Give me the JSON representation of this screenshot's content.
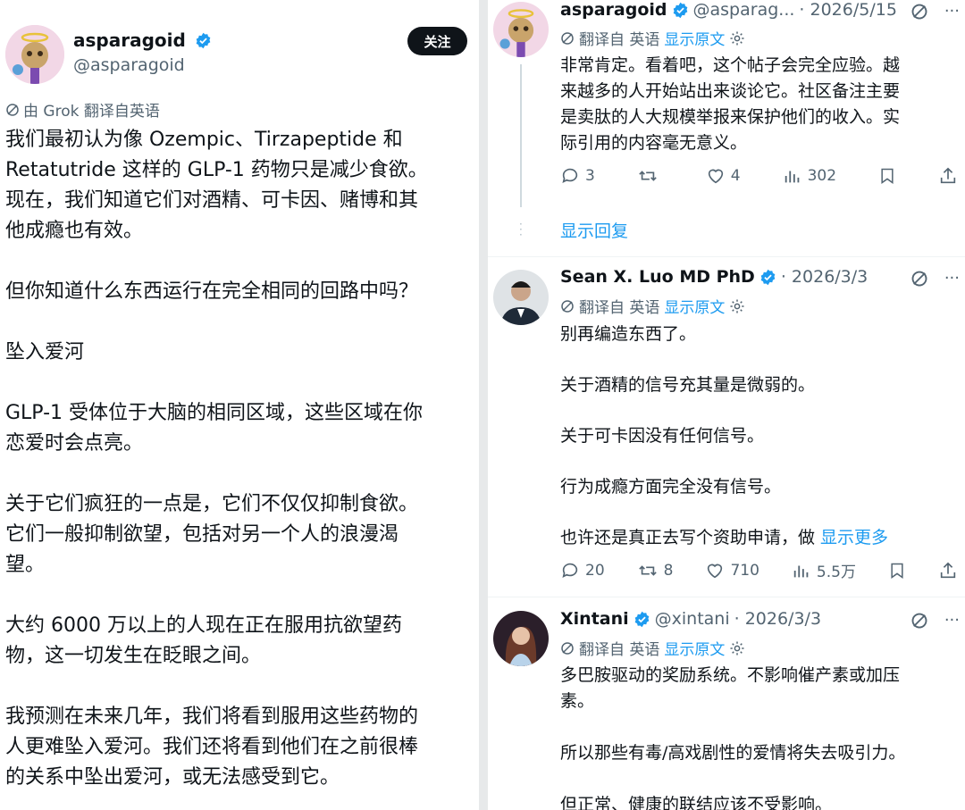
{
  "main_post": {
    "author_name": "asparagoid",
    "author_handle": "@asparagoid",
    "follow_label": "关注",
    "translation_note": "由 Grok 翻译自英语",
    "paragraphs": [
      "我们最初认为像 Ozempic、Tirzapeptide 和\nRetatutride 这样的 GLP-1 药物只是减少食欲。\n现在，我们知道它们对酒精、可卡因、赌博和其\n他成瘾也有效。",
      "但你知道什么东西运行在完全相同的回路中吗？",
      "坠入爱河",
      "GLP-1 受体位于大脑的相同区域，这些区域在你\n恋爱时会点亮。",
      "关于它们疯狂的一点是，它们不仅仅抑制食欲。\n它们一般抑制欲望，包括对另一个人的浪漫渴\n望。",
      "大约 6000 万以上的人现在正在服用抗欲望药\n物，这一切发生在眨眼之间。",
      "我预测在未来几年，我们将看到服用这些药物的\n人更难坠入爱河。我们还将看到他们在之前很棒\n的关系中坠出爱河，或无法感受到它。"
    ]
  },
  "replies": [
    {
      "author_name": "asparagoid",
      "author_handle": "@asparag...",
      "date": "· 2026/5/15",
      "translate_label": "翻译自 英语",
      "show_original": "显示原文",
      "text": "非常肯定。看着吧，这个帖子会完全应验。越\n来越多的人开始站出来谈论它。社区备注主要\n是卖肽的人大规模举报来保护他们的收入。实\n际引用的内容毫无意义。",
      "replies": "3",
      "reposts": "",
      "likes": "4",
      "views": "302",
      "show_replies": "显示回复"
    },
    {
      "author_name": "Sean X. Luo MD PhD",
      "author_handle": "",
      "date": "· 2026/3/3",
      "translate_label": "翻译自 英语",
      "show_original": "显示原文",
      "text_lines": [
        "别再编造东西了。",
        "关于酒精的信号充其量是微弱的。",
        "关于可卡因没有任何信号。",
        "行为成瘾方面完全没有信号。"
      ],
      "last_line": "也许还是真正去写个资助申请，做 ",
      "show_more": "显示更多",
      "replies": "20",
      "reposts": "8",
      "likes": "710",
      "views": "5.5万"
    },
    {
      "author_name": "Xintani",
      "author_handle": "@xintani",
      "date": "· 2026/3/3",
      "translate_label": "翻译自 英语",
      "show_original": "显示原文",
      "text1": "多巴胺驱动的奖励系统。不影响催产素或加压\n素。",
      "text2": "所以那些有毒/高戏剧性的爱情将失去吸引力。",
      "text3": "但正常、健康的联结应该不受影响。"
    }
  ],
  "colors": {
    "accent": "#1d9bf0",
    "text": "#0f1419",
    "muted": "#536471",
    "verified": "#1d9bf0"
  },
  "icons": [
    "verified-badge-icon",
    "translate-icon",
    "gear-icon",
    "grok-icon",
    "more-icon",
    "reply-icon",
    "repost-icon",
    "like-icon",
    "views-icon",
    "bookmark-icon",
    "share-icon"
  ]
}
